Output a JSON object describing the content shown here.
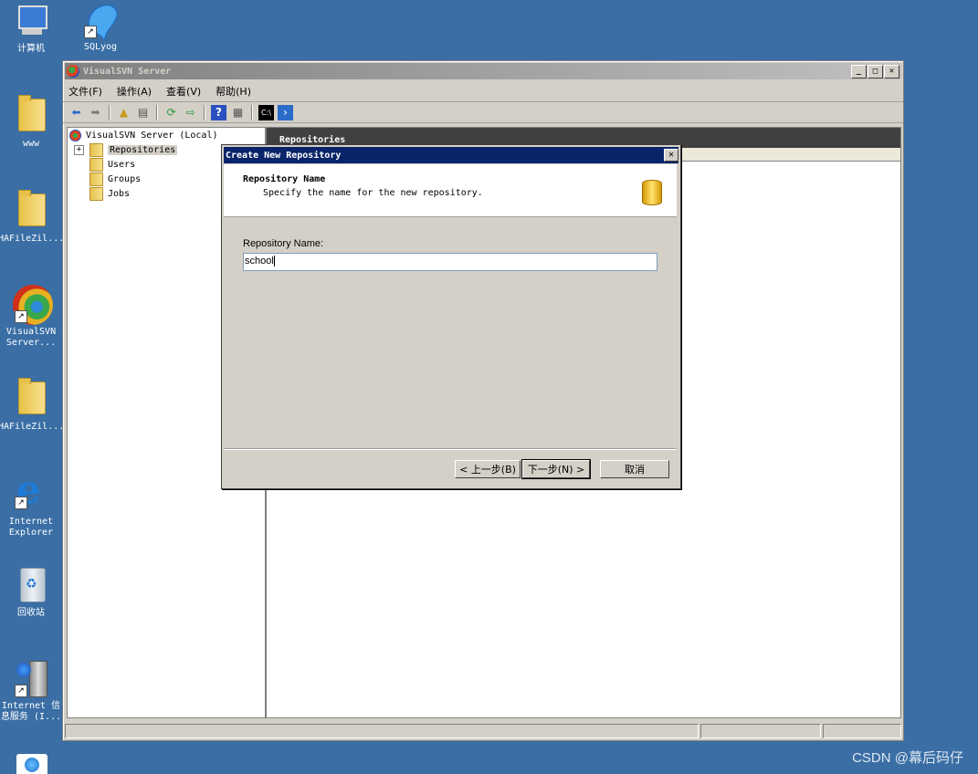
{
  "desktop": {
    "icons": [
      {
        "label": "计算机"
      },
      {
        "label": "SQLyog"
      },
      {
        "label": "www"
      },
      {
        "label": "HAFileZil..."
      },
      {
        "label": "VisualSVN\nServer..."
      },
      {
        "label": "HAFileZil..."
      },
      {
        "label": "Internet\nExplorer"
      },
      {
        "label": "回收站"
      },
      {
        "label": "Internet 信\n息服务 (I..."
      }
    ]
  },
  "window": {
    "title": "VisualSVN Server",
    "menu": [
      "文件(F)",
      "操作(A)",
      "查看(V)",
      "帮助(H)"
    ],
    "tree": {
      "root": "VisualSVN Server (Local)",
      "items": [
        "Repositories",
        "Users",
        "Groups",
        "Jobs"
      ]
    },
    "right_header": "Repositories"
  },
  "dialog": {
    "title": "Create New Repository",
    "heading": "Repository Name",
    "subheading": "Specify the name for the new repository.",
    "field_label": "Repository Name:",
    "field_value": "school",
    "buttons": {
      "back": "< 上一步(B)",
      "next": "下一步(N) >",
      "cancel": "取消"
    }
  },
  "watermark": "CSDN @幕后码仔"
}
